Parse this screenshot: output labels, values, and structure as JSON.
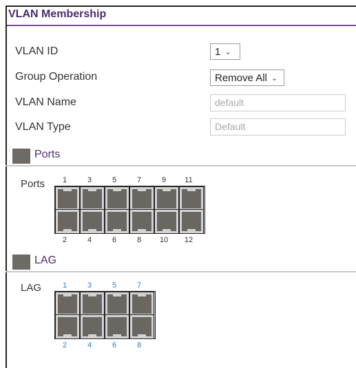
{
  "title": "VLAN Membership",
  "form": {
    "vlan_id_label": "VLAN ID",
    "vlan_id_value": "1",
    "group_operation_label": "Group Operation",
    "group_operation_value": "Remove All",
    "vlan_name_label": "VLAN Name",
    "vlan_name_placeholder": "default",
    "vlan_type_label": "VLAN Type",
    "vlan_type_placeholder": "Default"
  },
  "ports_section": {
    "heading": "Ports",
    "row_label": "Ports",
    "top_numbers": [
      "1",
      "3",
      "5",
      "7",
      "9",
      "11"
    ],
    "bottom_numbers": [
      "2",
      "4",
      "6",
      "8",
      "10",
      "12"
    ]
  },
  "lag_section": {
    "heading": "LAG",
    "row_label": "LAG",
    "top_numbers": [
      "1",
      "3",
      "5",
      "7"
    ],
    "bottom_numbers": [
      "2",
      "4",
      "6",
      "8"
    ]
  },
  "colors": {
    "title": "#4a2d6e",
    "title_underline": "#7a4a9a",
    "lag_numbers": "#2a7cc7",
    "port_fill": "#6a6661"
  }
}
